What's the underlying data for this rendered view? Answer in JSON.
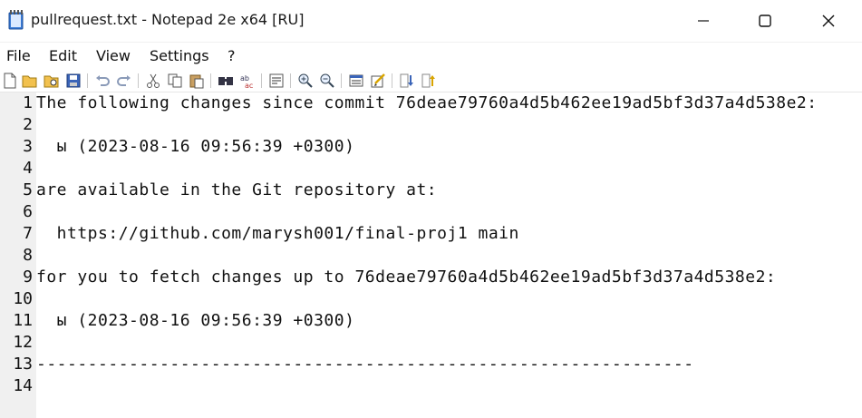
{
  "window": {
    "title": "pullrequest.txt - Notepad 2e x64 [RU]"
  },
  "menu": {
    "items": [
      {
        "label": "File"
      },
      {
        "label": "Edit"
      },
      {
        "label": "View"
      },
      {
        "label": "Settings"
      },
      {
        "label": "?"
      }
    ]
  },
  "toolbar": {
    "buttons": [
      "new-icon",
      "open-icon",
      "browse-icon",
      "save-icon",
      "undo-icon",
      "redo-icon",
      "cut-icon",
      "copy-icon",
      "paste-icon",
      "find-icon",
      "replace-icon",
      "wordwrap-icon",
      "zoom-in-icon",
      "zoom-out-icon",
      "scheme-icon",
      "customize-schemes-icon",
      "sort-icon",
      "sort-reverse-icon"
    ]
  },
  "editor": {
    "lines": [
      {
        "number": "1",
        "text": "The following changes since commit 76deae79760a4d5b462ee19ad5bf3d37a4d538e2:"
      },
      {
        "number": "2",
        "text": ""
      },
      {
        "number": "3",
        "text": "  ы (2023-08-16 09:56:39 +0300)"
      },
      {
        "number": "4",
        "text": ""
      },
      {
        "number": "5",
        "text": "are available in the Git repository at:"
      },
      {
        "number": "6",
        "text": ""
      },
      {
        "number": "7",
        "text": "  https://github.com/marysh001/final-proj1 main"
      },
      {
        "number": "8",
        "text": ""
      },
      {
        "number": "9",
        "text": "for you to fetch changes up to 76deae79760a4d5b462ee19ad5bf3d37a4d538e2:"
      },
      {
        "number": "10",
        "text": ""
      },
      {
        "number": "11",
        "text": "  ы (2023-08-16 09:56:39 +0300)"
      },
      {
        "number": "12",
        "text": ""
      },
      {
        "number": "13",
        "text": "----------------------------------------------------------------"
      },
      {
        "number": "14",
        "text": ""
      }
    ]
  }
}
